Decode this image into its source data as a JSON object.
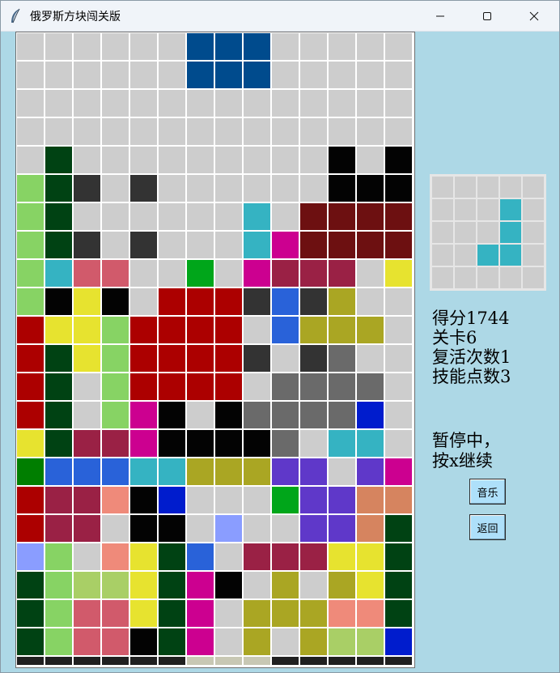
{
  "window": {
    "title": "俄罗斯方块闯关版",
    "controls": [
      "minimize-icon",
      "maximize-icon",
      "close-icon"
    ]
  },
  "colors": {
    "_": "#cdcdcd",
    "A": "#004b8d",
    "B": "#004213",
    "C": "#333333",
    "K": "#030303",
    "L": "#87d364",
    "T": "#35b3c2",
    "M": "#cc0090",
    "D": "#6d1011",
    "P": "#d15a6b",
    "G": "#00a61a",
    "Y": "#e7e32f",
    "W": "#9a2145",
    "R": "#ac0000",
    "U": "#2962d9",
    "O": "#aaa623",
    "H": "#6a6a6a",
    "N": "#001ccd",
    "E": "#007e00",
    "V": "#5f38c9",
    "S": "#ef8a7a",
    "Q": "#d6845f",
    "I": "#8a9dff",
    "J": "#a9cf66",
    "Z": "#202020",
    "X": "#c8c8b4"
  },
  "board": {
    "cols": 14,
    "rows": 23,
    "grid": [
      "______AAA_____",
      "______AAA_____",
      "______________",
      "______________",
      "_B_________K_K",
      "LBC_C______KKK",
      "LB______T_DDDD",
      "LBC_C___TMDDDD",
      "LTPP__G_MWWW_Y",
      "LKYK_RRRCUCO__",
      "RYYLRRRR_UOOO_",
      "RBYLRRRRC_CH__",
      "RB_LRRRR_HHHH_",
      "RB_LMK_KHHHHN_",
      "YBWWMKKKKH_TT_",
      "EUUUTTOOOVV_VM",
      "RWWSKN___GVVQQ",
      "RWW_KK_I__VVQB",
      "IL_SYBU_WWWYYB",
      "BLJJYBMK_O_OYB",
      "BLPPYBM_OOOSSB",
      "BLPPKBM_O_OJJN",
      "ZZZZZZXXXZZZZZ"
    ]
  },
  "preview": {
    "cols": 5,
    "rows": 5,
    "grid": [
      "_____",
      "___T_",
      "___T_",
      "__TT_",
      "_____"
    ]
  },
  "stats": {
    "score_line": "得分1744",
    "level_line": "关卡6",
    "revives_line": "复活次数1",
    "skill_points_line": "技能点数3"
  },
  "pause": {
    "line1": "暂停中，",
    "line2": "按x继续"
  },
  "buttons": {
    "music_label": "音乐",
    "back_label": "返回"
  }
}
